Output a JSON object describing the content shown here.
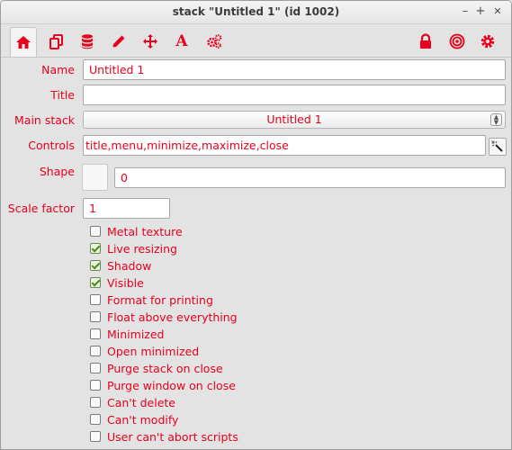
{
  "window": {
    "title": "stack \"Untitled 1\" (id 1002)",
    "controls": {
      "minimize": "–",
      "maximize": "+",
      "close": "✕"
    }
  },
  "toolbar": {
    "tabs": [
      {
        "name": "basic-properties",
        "icon": "home-icon",
        "active": true
      },
      {
        "name": "card-icons",
        "icon": "copy-icon",
        "active": false
      },
      {
        "name": "custom-properties",
        "icon": "database-icon",
        "active": false
      },
      {
        "name": "colors",
        "icon": "pencil-icon",
        "active": false
      },
      {
        "name": "size-position",
        "icon": "move-icon",
        "active": false
      },
      {
        "name": "text-formatting",
        "icon": "font-icon",
        "glyph": "A",
        "active": false
      },
      {
        "name": "advanced",
        "icon": "gears-icon",
        "active": false
      }
    ],
    "right_icons": [
      "lock-icon",
      "target-icon",
      "gear-icon"
    ]
  },
  "form": {
    "name_label": "Name",
    "name_value": "Untitled 1",
    "title_label": "Title",
    "title_value": "",
    "mainstack_label": "Main stack",
    "mainstack_value": "Untitled 1",
    "controls_label": "Controls",
    "controls_value": "title,menu,minimize,maximize,close",
    "shape_label": "Shape",
    "shape_value": "0",
    "scale_label": "Scale factor",
    "scale_value": "1"
  },
  "checkboxes": [
    {
      "label": "Metal texture",
      "checked": false
    },
    {
      "label": "Live resizing",
      "checked": true
    },
    {
      "label": "Shadow",
      "checked": true
    },
    {
      "label": "Visible",
      "checked": true
    },
    {
      "label": "Format for printing",
      "checked": false
    },
    {
      "label": "Float above everything",
      "checked": false
    },
    {
      "label": "Minimized",
      "checked": false
    },
    {
      "label": "Open minimized",
      "checked": false
    },
    {
      "label": "Purge stack on close",
      "checked": false
    },
    {
      "label": "Purge window on close",
      "checked": false
    },
    {
      "label": "Can't delete",
      "checked": false
    },
    {
      "label": "Can't modify",
      "checked": false
    },
    {
      "label": "User can't abort scripts",
      "checked": false
    }
  ],
  "colors": {
    "accent": "#e8001c",
    "background": "#e3e3e3"
  }
}
